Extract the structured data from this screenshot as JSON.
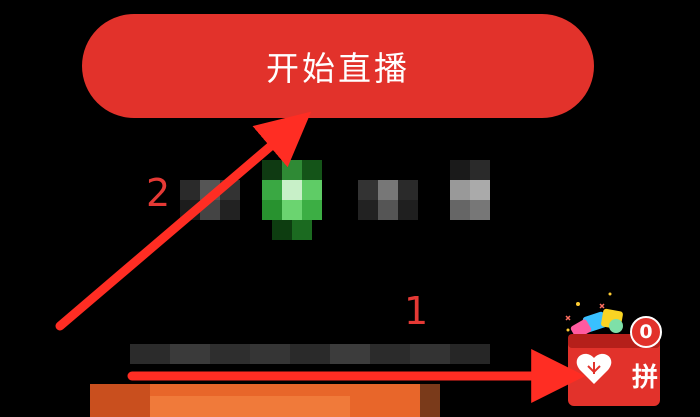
{
  "start_live_button": {
    "label": "开始直播"
  },
  "annotations": {
    "step_1": "1",
    "step_2": "2"
  },
  "gift_box": {
    "badge_count": "0",
    "icon": "gift-box-icon"
  },
  "colors": {
    "accent_red": "#e2322b",
    "annotation_red": "#e53935"
  }
}
